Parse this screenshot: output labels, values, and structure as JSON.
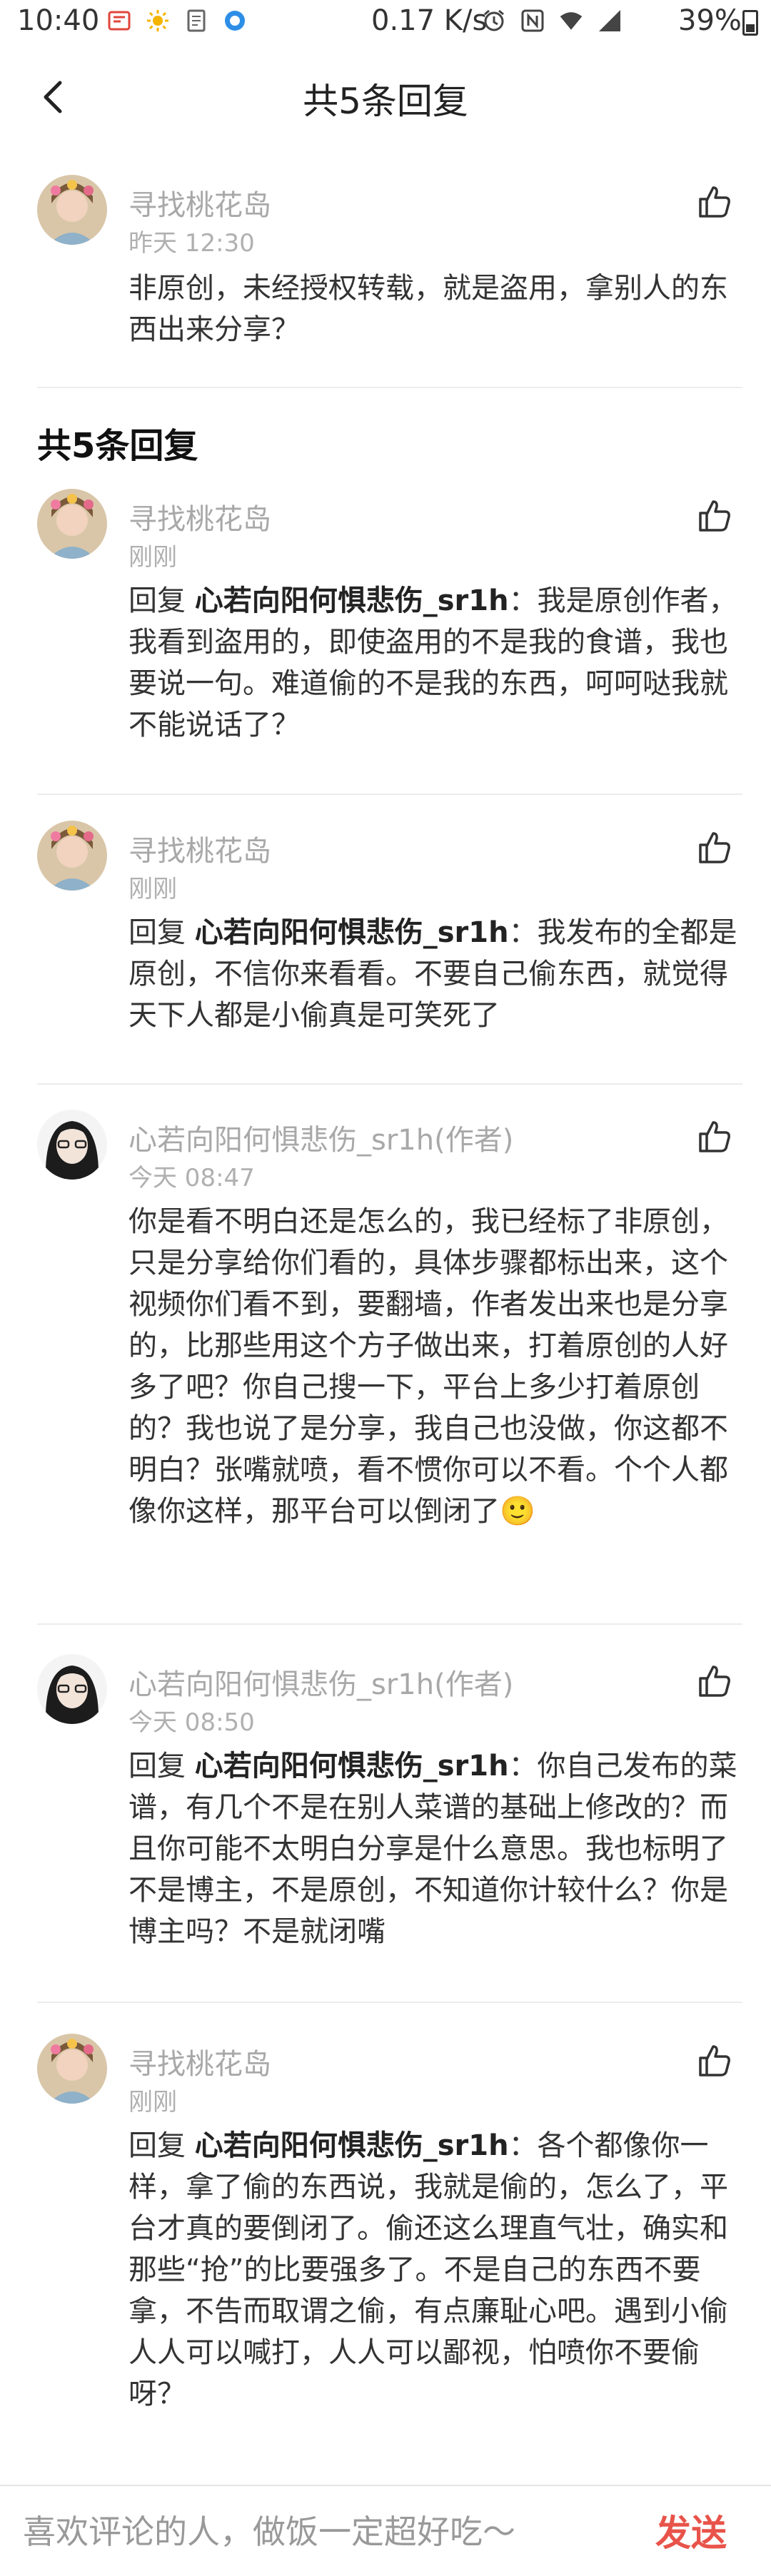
{
  "status_bar": {
    "time": "10:40",
    "speed": "0.17 K/s",
    "battery": "39%",
    "left_icons": [
      "app-notification-icon",
      "weather-sun-icon",
      "document-icon",
      "browser-icon"
    ],
    "right_icons": [
      "alarm-icon",
      "nfc-icon",
      "wifi-icon",
      "signal-icon"
    ]
  },
  "header": {
    "title": "共5条回复"
  },
  "section": {
    "title": "共5条回复"
  },
  "original_comment": {
    "name": "寻找桃花岛",
    "time": "昨天 12:30",
    "text": "非原创，未经授权转载，就是盗用，拿别人的东西出来分享？"
  },
  "replies": [
    {
      "name": "寻找桃花岛",
      "time": "刚刚",
      "reply_prefix": "回复 ",
      "reply_to": "心若向阳何惧悲伤_sr1h",
      "text": "：我是原创作者，我看到盗用的，即使盗用的不是我的食谱，我也要说一句。难道偷的不是我的东西，呵呵哒我就不能说话了？"
    },
    {
      "name": "寻找桃花岛",
      "time": "刚刚",
      "reply_prefix": "回复 ",
      "reply_to": "心若向阳何惧悲伤_sr1h",
      "text": "：我发布的全都是原创，不信你来看看。不要自己偷东西，就觉得天下人都是小偷真是可笑死了"
    },
    {
      "name": "心若向阳何惧悲伤_sr1h(作者)",
      "time": "今天 08:47",
      "text": "你是看不明白还是怎么的，我已经标了非原创，只是分享给你们看的，具体步骤都标出来，这个视频你们看不到，要翻墙，作者发出来也是分享的，比那些用这个方子做出来，打着原创的人好多了吧？你自己搜一下，平台上多少打着原创的？我也说了是分享，我自己也没做，你这都不明白？张嘴就喷，看不惯你可以不看。个个人都像你这样，那平台可以倒闭了🙂"
    },
    {
      "name": "心若向阳何惧悲伤_sr1h(作者)",
      "time": "今天 08:50",
      "reply_prefix": "回复 ",
      "reply_to": "心若向阳何惧悲伤_sr1h",
      "text": "：你自己发布的菜谱，有几个不是在别人菜谱的基础上修改的？而且你可能不太明白分享是什么意思。我也标明了不是博主，不是原创，不知道你计较什么？你是博主吗？不是就闭嘴"
    },
    {
      "name": "寻找桃花岛",
      "time": "刚刚",
      "reply_prefix": "回复 ",
      "reply_to": "心若向阳何惧悲伤_sr1h",
      "text": "：各个都像你一样，拿了偷的东西说，我就是偷的，怎么了，平台才真的要倒闭了。偷还这么理直气壮，确实和那些“抢”的比要强多了。不是自己的东西不要拿，不告而取谓之偷，有点廉耻心吧。遇到小偷人人可以喊打，人人可以鄙视，怕喷你不要偷呀？"
    }
  ],
  "bottom_bar": {
    "placeholder": "喜欢评论的人，做饭一定超好吃～",
    "send_label": "发送"
  },
  "colors": {
    "accent": "#e8534a",
    "name_gray": "#a8a8a8",
    "text": "#333333"
  }
}
